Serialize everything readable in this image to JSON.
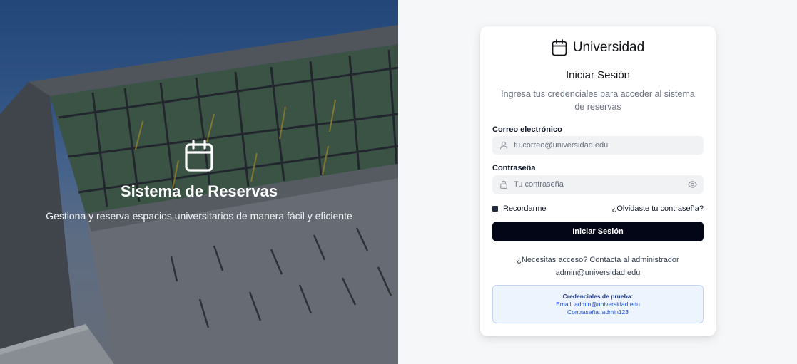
{
  "hero": {
    "title": "Sistema de Reservas",
    "subtitle": "Gestiona y reserva espacios universitarios de manera fácil y eficiente",
    "icon": "calendar-icon"
  },
  "brand": {
    "name": "Universidad",
    "icon": "calendar-icon"
  },
  "login": {
    "title": "Iniciar Sesión",
    "description": "Ingresa tus credenciales para acceder al sistema de reservas",
    "email": {
      "label": "Correo electrónico",
      "placeholder": "tu.correo@universidad.edu",
      "icon": "user-icon"
    },
    "password": {
      "label": "Contraseña",
      "placeholder": "Tu contraseña",
      "icon": "lock-icon",
      "toggle_icon": "eye-icon"
    },
    "remember_label": "Recordarme",
    "forgot_label": "¿Olvidaste tu contraseña?",
    "submit_label": "Iniciar Sesión",
    "help_line1": "¿Necesitas acceso? Contacta al administrador",
    "help_line2": "admin@universidad.edu"
  },
  "demo": {
    "title": "Credenciales de prueba:",
    "email_line": "Email: admin@universidad.edu",
    "password_line": "Contraseña: admin123"
  },
  "colors": {
    "primary_button": "#020617",
    "demo_background": "#eef4fe",
    "demo_border": "#bfd3f5",
    "demo_text": "#1d4ed8",
    "page_background": "#f6f7f9"
  }
}
